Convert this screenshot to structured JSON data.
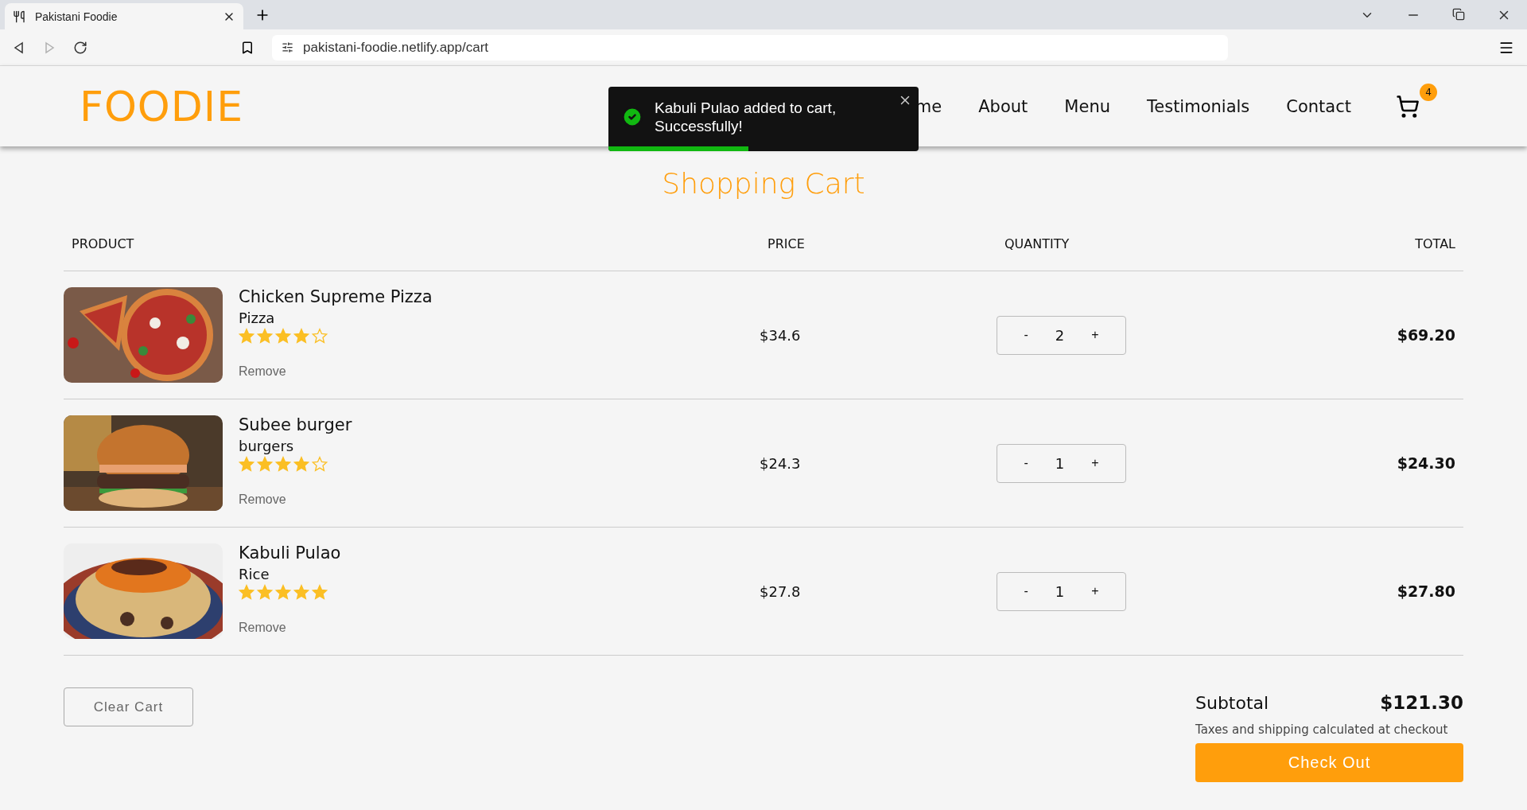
{
  "browser": {
    "tab": {
      "title": "Pakistani Foodie"
    },
    "url": "pakistani-foodie.netlify.app/cart",
    "nav_buttons": [
      {
        "kind": "back",
        "disabled": false
      },
      {
        "kind": "forward",
        "disabled": true
      },
      {
        "kind": "reload",
        "disabled": false
      }
    ]
  },
  "header": {
    "logo": "FOODIE",
    "nav": [
      {
        "label": "me"
      },
      {
        "label": "About"
      },
      {
        "label": "Menu"
      },
      {
        "label": "Testimonials"
      },
      {
        "label": "Contact"
      }
    ],
    "cart_count": "4"
  },
  "toast": {
    "message": "Kabuli Pulao added to cart, Successfully!",
    "level": 0.45
  },
  "title": "Shopping Cart",
  "table": {
    "columns": [
      "PRODUCT",
      "PRICE",
      "QUANTITY",
      "TOTAL"
    ],
    "rows": [
      {
        "name": "Chicken Supreme Pizza",
        "category": "Pizza",
        "stars": 4,
        "remove": "Remove",
        "price": "$34.6",
        "quantity": "2",
        "total": "$69.20"
      },
      {
        "name": "Subee burger",
        "category": "burgers",
        "stars": 4,
        "remove": "Remove",
        "price": "$24.3",
        "quantity": "1",
        "total": "$24.30"
      },
      {
        "name": "Kabuli Pulao",
        "category": "Rice",
        "stars": 5,
        "remove": "Remove",
        "price": "$27.8",
        "quantity": "1",
        "total": "$27.80"
      }
    ]
  },
  "stepper": {
    "minus": "-",
    "plus": "+"
  },
  "clear_button": "Clear Cart",
  "summary": {
    "label": "Subtotal",
    "value": "$121.30",
    "note": "Taxes and shipping calculated at checkout",
    "checkout": "Check Out"
  }
}
